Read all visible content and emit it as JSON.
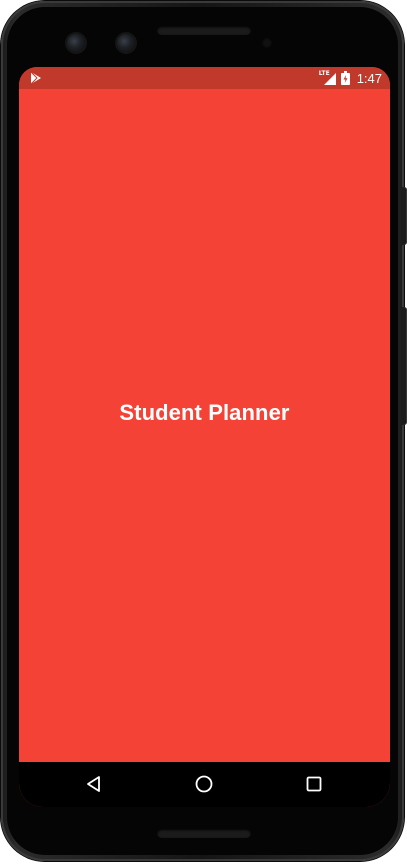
{
  "status_bar": {
    "time": "1:47",
    "network_label": "LTE",
    "icons": [
      "play-store-icon",
      "lte-signal-icon",
      "battery-charging-icon"
    ],
    "color": "#C0392B"
  },
  "app": {
    "title": "Student Planner",
    "background_color": "#F44336",
    "text_color": "#FFFFFF"
  },
  "nav_bar": {
    "buttons": [
      "back-icon",
      "home-icon",
      "recents-icon"
    ],
    "color": "#000000"
  }
}
